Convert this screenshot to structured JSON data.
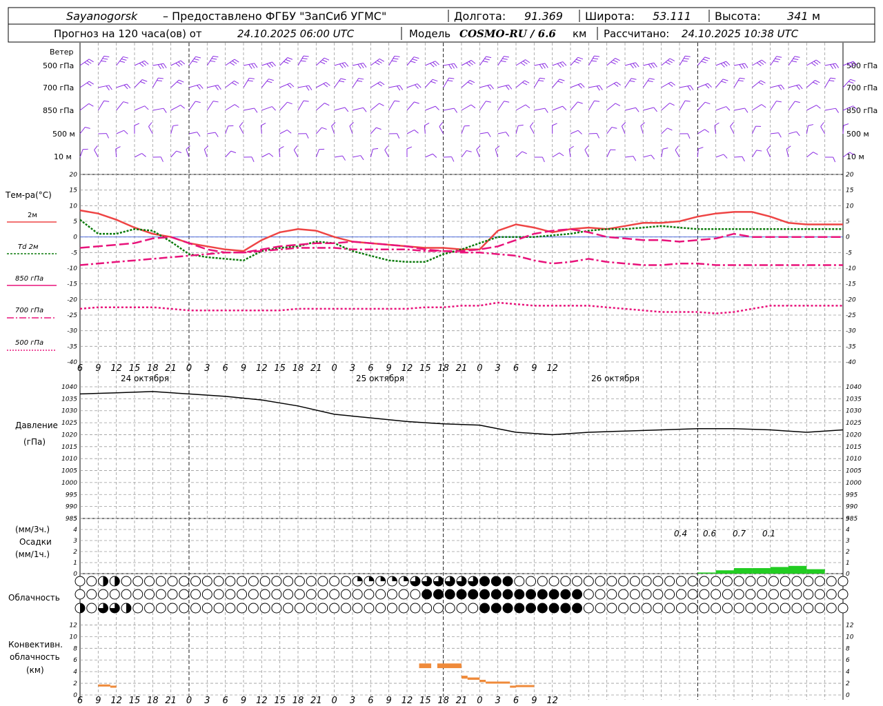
{
  "header": {
    "place": "Sayanogorsk",
    "provider": "– Предоставлено ФГБУ \"ЗапСиб УГМС\"",
    "lon_label": "Долгота:",
    "lon": "91.369",
    "lat_label": "Широта:",
    "lat": "53.111",
    "alt_label": "Высота:",
    "alt": "341",
    "alt_unit": "м",
    "forecast_prefix": "Прогноз на 120 часа(ов) от",
    "forecast_start": "24.10.2025 06:00 UTC",
    "model_label": "Модель",
    "model": "COSMO-RU / 6.6",
    "model_unit": "км",
    "calc_label": "Рассчитано:",
    "calc_time": "24.10.2025 10:38 UTC"
  },
  "wind_panel": {
    "title": "Ветер",
    "levels": [
      "500 гПа",
      "700 гПа",
      "850 гПа",
      "500 м",
      "10  м"
    ]
  },
  "temp_panel": {
    "title": "Тем-ра(°C)",
    "legend": [
      "2м",
      "Td  2м",
      "850 гПа",
      "700 гПа",
      "500 гПа"
    ]
  },
  "x_axis": {
    "hour_labels": [
      "6",
      "9",
      "12",
      "15",
      "18",
      "21",
      "0",
      "3",
      "6",
      "9",
      "12",
      "15",
      "18",
      "21",
      "0",
      "3",
      "6",
      "9",
      "12",
      "15",
      "18",
      "21",
      "0",
      "3",
      "6",
      "9",
      "12"
    ],
    "day_labels": [
      "24 октября",
      "25 октября",
      "26 октября"
    ]
  },
  "pressure_panel": {
    "title1": "Давление",
    "title2": "(гПа)"
  },
  "precip_panel": {
    "unit1": "(мм/3ч.)",
    "title": "Осадки",
    "unit2": "(мм/1ч.)",
    "totals": [
      "0.4",
      "0.6",
      "0.7",
      "0.1"
    ]
  },
  "cloud_panel": {
    "title": "Облачность"
  },
  "conv_panel": {
    "title1": "Конвективн.",
    "title2": "облачность",
    "title3": "(км)"
  },
  "colors": {
    "t2m": "#ee4444",
    "td2m": "#0a7a0a",
    "t850": "#e8127a",
    "t700": "#e8127a",
    "t500": "#e8127a",
    "wind": "#8a2be2",
    "precip": "#22cc22",
    "conv": "#ef8a3a",
    "pressure": "#000000"
  },
  "chart_data": [
    {
      "type": "line",
      "name": "temperature",
      "x_hours_from_start": [
        0,
        3,
        6,
        9,
        12,
        15,
        18,
        21,
        24,
        27,
        30,
        33,
        36,
        39,
        42,
        45,
        48,
        51,
        54,
        57,
        60,
        63,
        66,
        69,
        72,
        75,
        78,
        81,
        84,
        87,
        90,
        93,
        96,
        99,
        102,
        105,
        108,
        111,
        114,
        117,
        120,
        123,
        126
      ],
      "ylim": [
        -40,
        20
      ],
      "series": [
        {
          "name": "2м",
          "values": [
            8.5,
            7.5,
            5.5,
            3,
            1,
            0,
            -2,
            -3,
            -4,
            -4.5,
            -1,
            1.5,
            2.5,
            2,
            0,
            -1.5,
            -2,
            -2.5,
            -3,
            -3.5,
            -3.5,
            -4,
            -4,
            2,
            4,
            3,
            1.5,
            2.5,
            3,
            2.5,
            3.5,
            4.5,
            4.5,
            5,
            6.5,
            7.5,
            8,
            8,
            6.5,
            4.5,
            4,
            4,
            4
          ]
        },
        {
          "name": "Td  2м",
          "values": [
            5.5,
            1,
            1,
            2.5,
            2,
            -1.5,
            -5.5,
            -6.5,
            -7,
            -7.5,
            -4.5,
            -3.5,
            -3,
            -1.5,
            -2,
            -4.5,
            -6,
            -7.5,
            -8,
            -8,
            -5.5,
            -4,
            -2,
            0,
            0,
            0,
            0.5,
            1,
            2,
            2.5,
            2.5,
            3,
            3.5,
            3,
            2.5,
            2.5,
            2.5,
            2.5,
            2.5,
            2.5,
            2.5,
            2.5,
            2.5
          ]
        },
        {
          "name": "850 гПа",
          "values": [
            -3.5,
            -3,
            -2.5,
            -2,
            -0.5,
            0,
            -2,
            -4,
            -5,
            -5,
            -4,
            -3,
            -2.5,
            -2,
            -2,
            -1.5,
            -2,
            -2.5,
            -3,
            -4,
            -4.5,
            -4.5,
            -4,
            -3,
            -1,
            1,
            2,
            2.5,
            1.5,
            0,
            -0.5,
            -1,
            -1,
            -1.5,
            -1,
            -0.5,
            1,
            0,
            0,
            0,
            0,
            0,
            0
          ]
        },
        {
          "name": "700 гПа",
          "values": [
            -9,
            -8.5,
            -8,
            -7.5,
            -7,
            -6.5,
            -6,
            -5.5,
            -5,
            -5,
            -4.5,
            -4,
            -3.5,
            -3.5,
            -3.5,
            -4,
            -4,
            -4,
            -4,
            -4.5,
            -4.5,
            -5,
            -5,
            -5.5,
            -6,
            -7.5,
            -8.5,
            -8,
            -7,
            -8,
            -8.5,
            -9,
            -9,
            -8.5,
            -8.5,
            -9,
            -9,
            -9,
            -9,
            -9,
            -9,
            -9,
            -9
          ]
        },
        {
          "name": "500 гПа",
          "values": [
            -23,
            -22.5,
            -22.5,
            -22.5,
            -22.5,
            -23,
            -23.5,
            -23.5,
            -23.5,
            -23.5,
            -23.5,
            -23.5,
            -23,
            -23,
            -23,
            -23,
            -23,
            -23,
            -23,
            -22.5,
            -22.5,
            -22,
            -22,
            -21,
            -21.5,
            -22,
            -22,
            -22,
            -22,
            -22.5,
            -23,
            -23.5,
            -24,
            -24,
            -24,
            -24.5,
            -24,
            -23,
            -22,
            -22,
            -22,
            -22,
            -22
          ]
        }
      ]
    },
    {
      "type": "line",
      "name": "pressure",
      "x_hours_from_start": [
        0,
        6,
        12,
        18,
        24,
        30,
        36,
        42,
        48,
        54,
        60,
        66,
        72,
        78,
        84,
        90,
        96,
        102,
        108,
        114,
        120,
        126
      ],
      "ylim": [
        985,
        1040
      ],
      "series": [
        {
          "name": "Давление",
          "values": [
            1037,
            1037.5,
            1038,
            1037,
            1036,
            1034.5,
            1032,
            1028.5,
            1027,
            1025.5,
            1024.5,
            1024,
            1021,
            1020,
            1021,
            1021.5,
            1022,
            1022.5,
            1022.5,
            1022,
            1021,
            1022
          ]
        }
      ]
    },
    {
      "type": "bar",
      "name": "precipitation",
      "x_hours_from_start": [
        102,
        105,
        108,
        111,
        114,
        117,
        120
      ],
      "ylim": [
        0,
        5
      ],
      "series": [
        {
          "name": "Осадки",
          "values": [
            0.1,
            0.3,
            0.5,
            0.5,
            0.6,
            0.7,
            0.4
          ]
        }
      ]
    },
    {
      "type": "bar",
      "name": "convective_cloud",
      "ylim": [
        0,
        13
      ],
      "segments": [
        {
          "start_hour": 3,
          "end_hour": 5,
          "base": 1.5,
          "top": 1.8
        },
        {
          "start_hour": 5,
          "end_hour": 6,
          "base": 1.4,
          "top": 1.6
        },
        {
          "start_hour": 56,
          "end_hour": 58,
          "base": 4.6,
          "top": 5.4
        },
        {
          "start_hour": 59,
          "end_hour": 63,
          "base": 4.6,
          "top": 5.4
        },
        {
          "start_hour": 63,
          "end_hour": 64,
          "base": 2.8,
          "top": 3.3
        },
        {
          "start_hour": 64,
          "end_hour": 66,
          "base": 2.6,
          "top": 3.0
        },
        {
          "start_hour": 66,
          "end_hour": 67,
          "base": 2.2,
          "top": 2.6
        },
        {
          "start_hour": 67,
          "end_hour": 71,
          "base": 2.0,
          "top": 2.3
        },
        {
          "start_hour": 71,
          "end_hour": 72,
          "base": 1.3,
          "top": 1.6
        },
        {
          "start_hour": 72,
          "end_hour": 75,
          "base": 1.4,
          "top": 1.7
        }
      ]
    }
  ]
}
